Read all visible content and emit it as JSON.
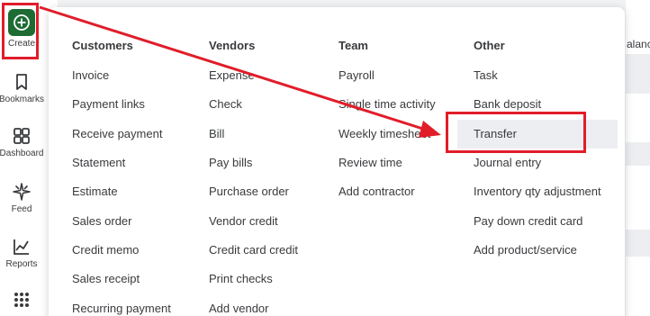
{
  "nav": {
    "items": [
      {
        "name": "create",
        "label": "Create",
        "icon": "plus-circle-icon"
      },
      {
        "name": "bookmarks",
        "label": "Bookmarks",
        "icon": "bookmark-icon"
      },
      {
        "name": "dashboard",
        "label": "Dashboard",
        "icon": "dashboard-icon"
      },
      {
        "name": "feed",
        "label": "Feed",
        "icon": "sparkle-icon"
      },
      {
        "name": "reports",
        "label": "Reports",
        "icon": "line-chart-icon"
      },
      {
        "name": "apps",
        "label": "",
        "icon": "grid-dots-icon"
      }
    ]
  },
  "background": {
    "right_text": "alance"
  },
  "menu": {
    "columns": [
      {
        "heading": "Customers",
        "items": [
          "Invoice",
          "Payment links",
          "Receive payment",
          "Statement",
          "Estimate",
          "Sales order",
          "Credit memo",
          "Sales receipt",
          "Recurring payment"
        ]
      },
      {
        "heading": "Vendors",
        "items": [
          "Expense",
          "Check",
          "Bill",
          "Pay bills",
          "Purchase order",
          "Vendor credit",
          "Credit card credit",
          "Print checks",
          "Add vendor"
        ]
      },
      {
        "heading": "Team",
        "items": [
          "Payroll",
          "Single time activity",
          "Weekly timesheet",
          "Review time",
          "Add contractor"
        ]
      },
      {
        "heading": "Other",
        "items": [
          "Task",
          "Bank deposit",
          "Transfer",
          "Journal entry",
          "Inventory qty adjustment",
          "Pay down credit card",
          "Add product/service"
        ]
      }
    ],
    "highlighted_item": "Transfer"
  },
  "colors": {
    "create_button": "#1e6b34",
    "annotation_red": "#e11d2a",
    "highlight_bg": "#eceef1"
  }
}
